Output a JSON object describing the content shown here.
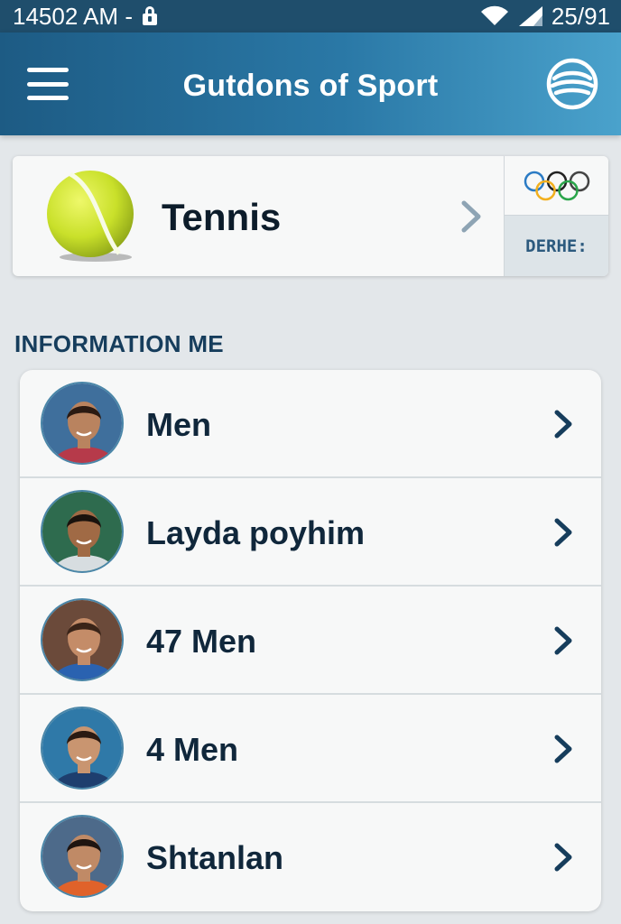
{
  "status_bar": {
    "time": "14502 AM -",
    "battery_text": "25/91"
  },
  "app_bar": {
    "title": "Gutdons of Sport"
  },
  "sport_card": {
    "name": "Tennis",
    "side_tag": "DERHE:"
  },
  "section": {
    "title": "INFORMATION ME"
  },
  "list": {
    "items": [
      {
        "label": "Men",
        "avatar_bg": "#3f6f9c",
        "skin": "#b9835f",
        "hair": "#2a1a12",
        "shirt": "#b63a4a"
      },
      {
        "label": "Layda poyhim",
        "avatar_bg": "#2e6b4e",
        "skin": "#a06a45",
        "hair": "#1a120d",
        "shirt": "#d7dde0"
      },
      {
        "label": "47 Men",
        "avatar_bg": "#6b4a3a",
        "skin": "#c48c68",
        "hair": "#3a2418",
        "shirt": "#2a62b0"
      },
      {
        "label": "4 Men",
        "avatar_bg": "#2f79a8",
        "skin": "#c99570",
        "hair": "#2a1a12",
        "shirt": "#1e3e6e"
      },
      {
        "label": "Shtanlan",
        "avatar_bg": "#4d6a8a",
        "skin": "#c08a66",
        "hair": "#1e1410",
        "shirt": "#e0622a"
      }
    ]
  },
  "colors": {
    "accent": "#1d5b84",
    "chevron": "#163d5c"
  }
}
